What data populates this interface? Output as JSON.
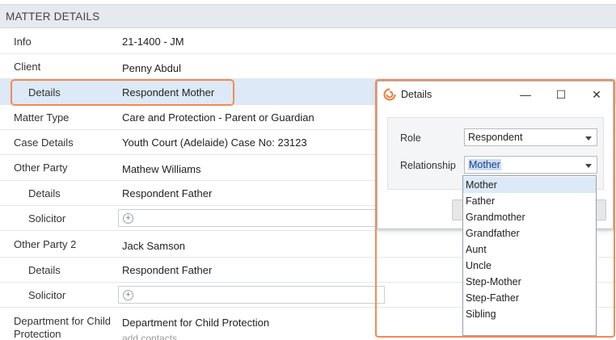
{
  "section": {
    "title": "MATTER DETAILS"
  },
  "rows": {
    "info": {
      "label": "Info",
      "value": "21-1400 - JM"
    },
    "client": {
      "label": "Client",
      "value": "Penny Abdul"
    },
    "client_details": {
      "label": "Details",
      "value": "Respondent Mother"
    },
    "matter_type": {
      "label": "Matter Type",
      "value": "Care and Protection - Parent or Guardian"
    },
    "case_details": {
      "label": "Case Details",
      "value": "Youth Court (Adelaide) Case No: 23123"
    },
    "other_party": {
      "label": "Other Party",
      "value": "Mathew Williams"
    },
    "other_party_details": {
      "label": "Details",
      "value": "Respondent Father"
    },
    "other_party_solicitor": {
      "label": "Solicitor"
    },
    "other_party_2": {
      "label": "Other Party 2",
      "value": "Jack Samson"
    },
    "other_party_2_details": {
      "label": "Details",
      "value": "Respondent Father"
    },
    "other_party_2_solicitor": {
      "label": "Solicitor"
    },
    "department": {
      "label_line1": "Department for Child",
      "label_line2": "Protection",
      "value": "Department for Child Protection",
      "add_contacts": "add contacts"
    }
  },
  "dialog": {
    "title": "Details",
    "role_label": "Role",
    "role_value": "Respondent",
    "relationship_label": "Relationship",
    "relationship_value": "Mother",
    "window_buttons": {
      "minimize": "—",
      "maximize": "☐",
      "close": "✕"
    }
  },
  "relationship_options": [
    "Mother",
    "Father",
    "Grandmother",
    "Grandfather",
    "Aunt",
    "Uncle",
    "Step-Mother",
    "Step-Father",
    "Sibling"
  ],
  "colors": {
    "highlight": "#f28b54",
    "selected_row": "#dde9f7",
    "header_bg": "#e6e9ee"
  }
}
